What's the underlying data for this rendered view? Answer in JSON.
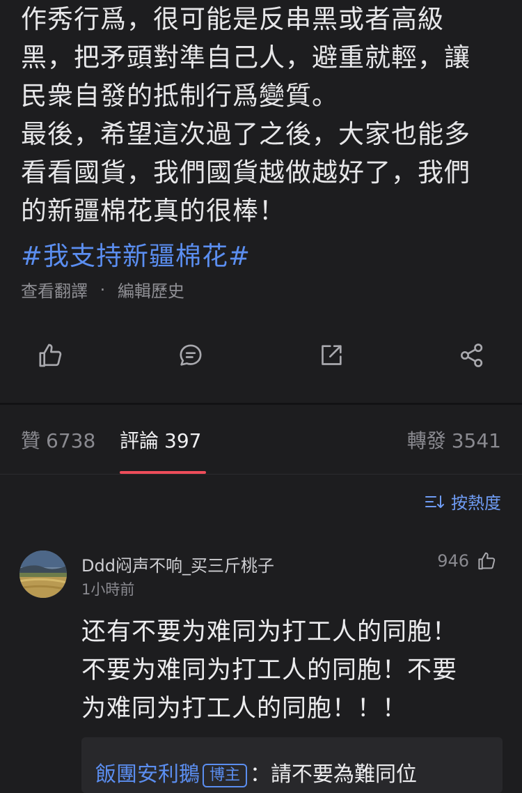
{
  "post": {
    "lines": [
      "作秀行爲，很可能是反串黑或者高級",
      "黑，把矛頭對準自己人，避重就輕，讓",
      "民衆自發的抵制行爲變質。",
      "最後，希望這次過了之後，大家也能多",
      "看看國貨，我們國貨越做越好了，我們",
      "的新疆棉花真的很棒！"
    ],
    "hashtag": "#我支持新疆棉花#",
    "view_translation": "查看翻譯",
    "separator": "·",
    "edit_history": "編輯歷史"
  },
  "actions": [
    "like-icon",
    "comment-icon",
    "repost-icon",
    "share-icon"
  ],
  "stats": {
    "likes_label": "贊",
    "likes_count": "6738",
    "comments_label": "評論",
    "comments_count": "397",
    "reposts_label": "轉發",
    "reposts_count": "3541"
  },
  "sort_label": "按熱度",
  "comment": {
    "username": "Ddd闷声不响_买三斤桃子",
    "time": "1小時前",
    "likes": "946",
    "body_lines": [
      "还有不要为难同为打工人的同胞！",
      "不要为难同为打工人的同胞！不要",
      "为难同为打工人的同胞！！！"
    ],
    "reply": {
      "name": "飯團安利鵝",
      "badge": "博主",
      "text": "：請不要為難同位"
    }
  },
  "colors": {
    "background": "#1d1d1f",
    "link_blue": "#5b8ef0",
    "active_tab_underline": "#ee4d5a"
  }
}
